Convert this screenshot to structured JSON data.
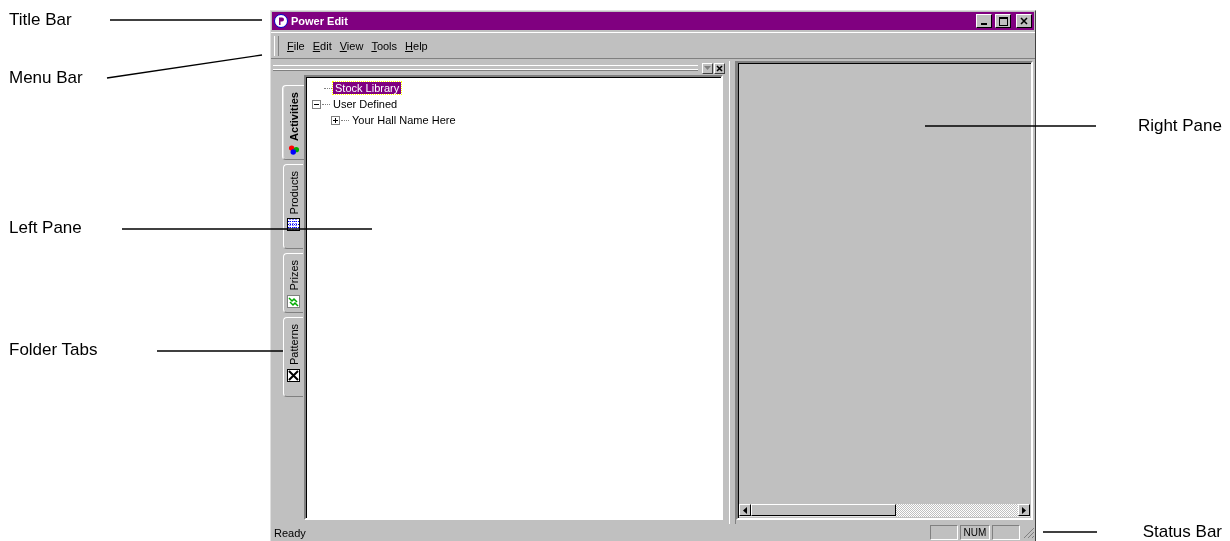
{
  "window": {
    "title": "Power Edit"
  },
  "menu": [
    "File",
    "Edit",
    "View",
    "Tools",
    "Help"
  ],
  "folder_tabs": [
    {
      "label": "Activities",
      "selected": true
    },
    {
      "label": "Products",
      "selected": false
    },
    {
      "label": "Prizes",
      "selected": false
    },
    {
      "label": "Patterns",
      "selected": false
    }
  ],
  "tree": [
    {
      "label": "Stock Library",
      "selected": true
    },
    {
      "label": "User Defined",
      "selected": false,
      "expanded": true,
      "children": [
        {
          "label": "Your Hall Name Here",
          "selected": false,
          "expanded": false
        }
      ]
    }
  ],
  "status_bar": {
    "message": "Ready",
    "indicator": "NUM"
  },
  "annotations": [
    {
      "label": "Title Bar"
    },
    {
      "label": "Menu Bar"
    },
    {
      "label": "Left Pane"
    },
    {
      "label": "Folder Tabs"
    },
    {
      "label": "Right Pane"
    },
    {
      "label": "Status Bar"
    }
  ]
}
